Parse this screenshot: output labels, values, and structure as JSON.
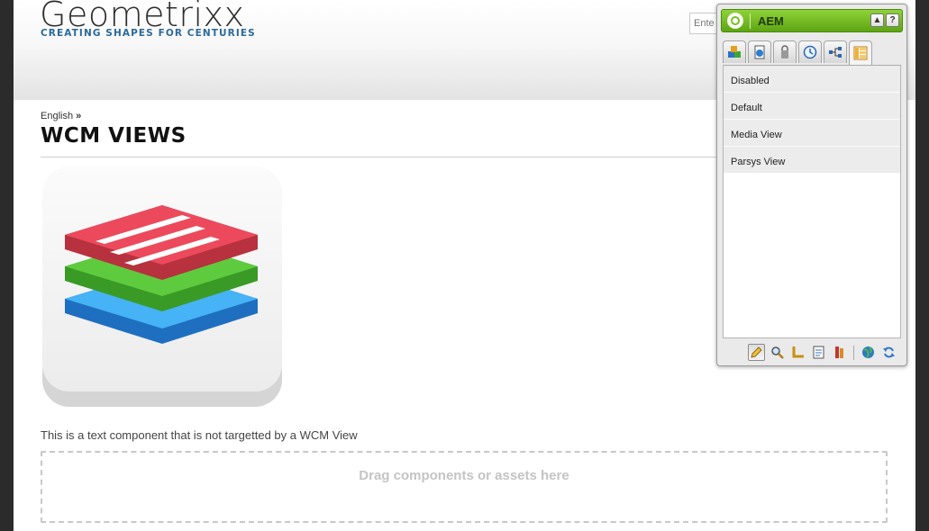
{
  "header": {
    "logo_title": "Geometrixx",
    "logo_tagline": "CREATING SHAPES FOR CENTURIES",
    "search_placeholder": "Ente"
  },
  "breadcrumb": {
    "item": "English",
    "separator": "»"
  },
  "page": {
    "title": "WCM VIEWS",
    "text_component": "This is a text component that is not targetted by a WCM View",
    "dropzone_label": "Drag components or assets here"
  },
  "sidekick": {
    "title": "AEM",
    "collapse_label": "▲",
    "help_label": "?",
    "tabs": [
      "components-icon",
      "page-icon",
      "versioning-icon",
      "workflow-icon",
      "sitemap-icon",
      "views-icon"
    ],
    "active_tab": "views-icon",
    "items": [
      {
        "label": "Disabled"
      },
      {
        "label": "Default"
      },
      {
        "label": "Media View"
      },
      {
        "label": "Parsys View"
      }
    ],
    "tools": [
      "edit-mode-icon",
      "preview-icon",
      "design-mode-icon",
      "page-properties-icon",
      "client-context-icon",
      "website-icon",
      "refresh-icon"
    ],
    "active_tool": "edit-mode-icon"
  },
  "colors": {
    "brand_green": "#6fb52a",
    "tagline_blue": "#2a6a9a",
    "stack_red": "#e8475a",
    "stack_green": "#5cc43c",
    "stack_blue": "#2f8fe0"
  }
}
